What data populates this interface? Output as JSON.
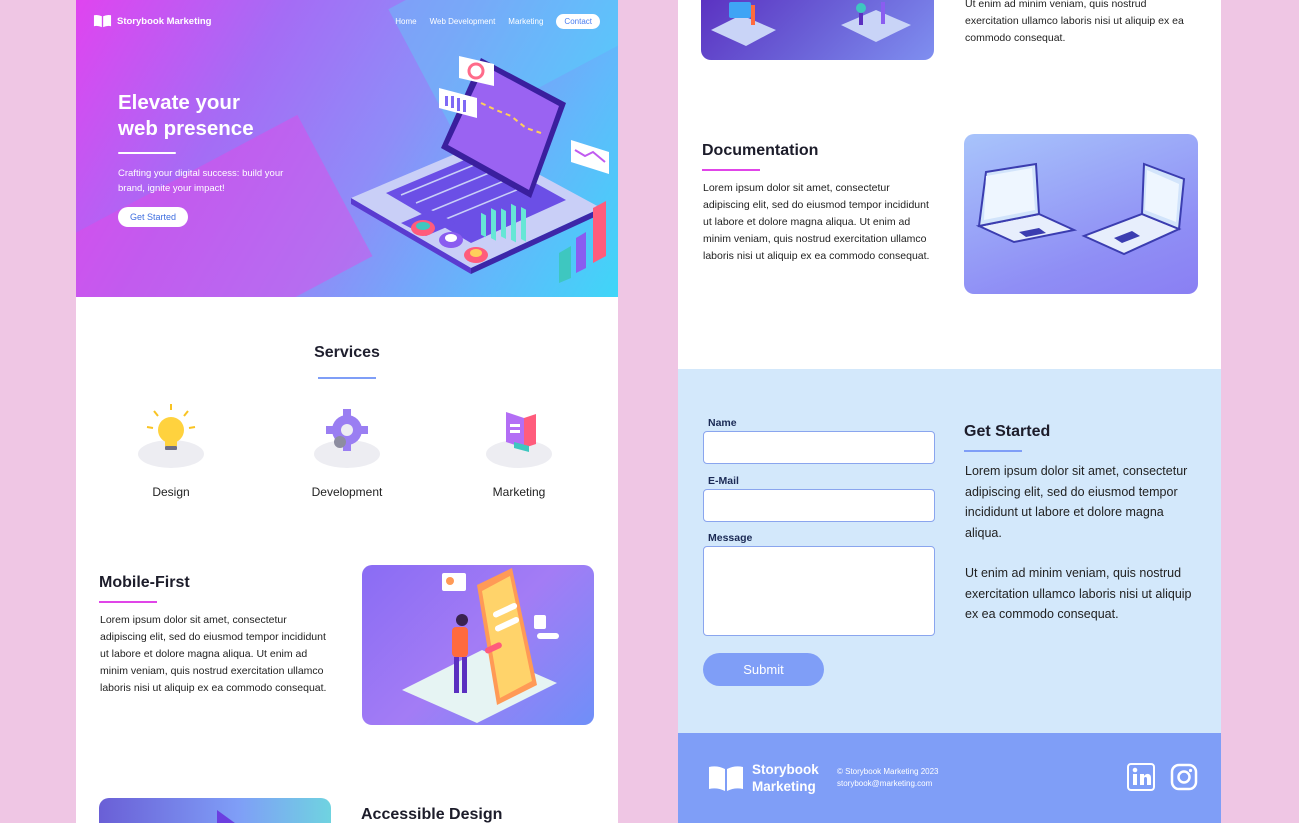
{
  "brand": {
    "name": "Storybook Marketing"
  },
  "nav": [
    "Home",
    "Web Development",
    "Marketing",
    "Contact"
  ],
  "hero": {
    "title_line1": "Elevate your",
    "title_line2": "web presence",
    "subtitle": "Crafting your digital success: build your brand, ignite your impact!",
    "cta": "Get Started"
  },
  "services": {
    "title": "Services",
    "items": [
      "Design",
      "Development",
      "Marketing"
    ]
  },
  "mobile_first": {
    "title": "Mobile-First",
    "text": "Lorem ipsum dolor sit amet, consectetur adipiscing elit, sed do eiusmod tempor incididunt ut labore et dolore magna aliqua. Ut enim ad minim veniam, quis nostrud exercitation ullamco laboris nisi ut aliquip ex ea commodo consequat."
  },
  "accessible": {
    "title": "Accessible Design"
  },
  "top_right_text": "Ut enim ad minim veniam, quis nostrud exercitation ullamco laboris nisi ut aliquip ex ea commodo consequat.",
  "documentation": {
    "title": "Documentation",
    "text": "Lorem ipsum dolor sit amet, consectetur adipiscing elit, sed do eiusmod tempor incididunt ut labore et dolore magna aliqua. Ut enim ad minim veniam, quis nostrud exercitation ullamco laboris nisi ut aliquip ex ea commodo consequat."
  },
  "form": {
    "name_label": "Name",
    "email_label": "E-Mail",
    "message_label": "Message",
    "name_value": "",
    "email_value": "",
    "message_value": "",
    "submit": "Submit"
  },
  "get_started": {
    "title": "Get Started",
    "para1": "Lorem ipsum dolor sit amet, consectetur adipiscing elit, sed do eiusmod tempor incididunt ut labore et dolore magna aliqua.",
    "para2": "Ut enim ad minim veniam, quis nostrud exercitation ullamco laboris nisi ut aliquip ex ea commodo consequat."
  },
  "footer": {
    "brand_line1": "Storybook",
    "brand_line2": "Marketing",
    "copyright": "© Storybook Marketing 2023",
    "email": "storybook@marketing.com",
    "icons": [
      "linkedin-icon",
      "instagram-icon"
    ]
  },
  "colors": {
    "accent": "#7f9ef7",
    "background": "#efc6e4",
    "contact_bg": "#d3e8fb",
    "underline_pink": "#e045e8"
  }
}
